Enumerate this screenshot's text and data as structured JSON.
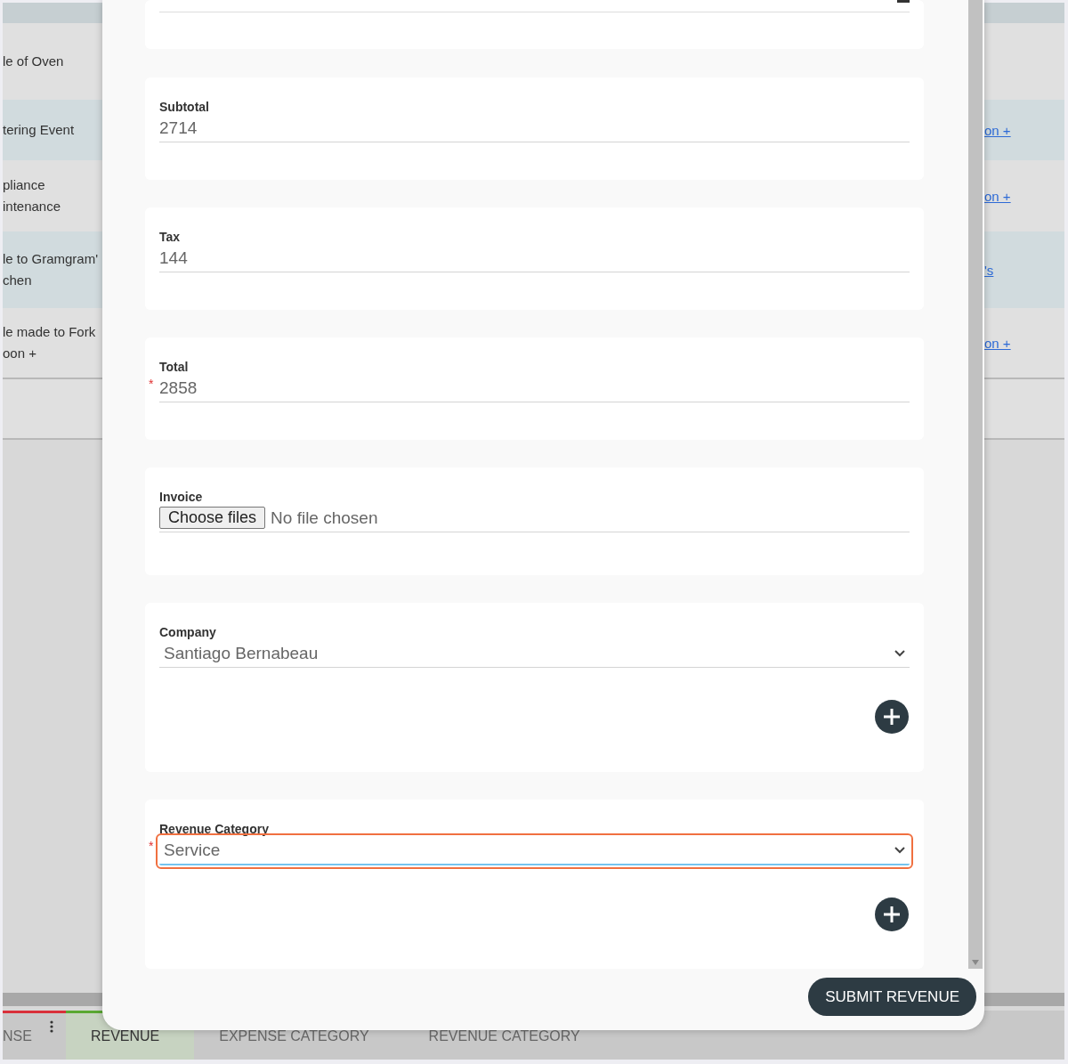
{
  "background_table": {
    "rows": [
      {
        "column_1": [
          "le of Oven"
        ]
      },
      {
        "column_1": [
          "tering Event"
        ],
        "column_2": "on +"
      },
      {
        "column_1": [
          "pliance",
          "intenance"
        ],
        "column_2": "on +"
      },
      {
        "column_1": [
          "le to Gramgram'",
          "chen"
        ],
        "column_2": "'s"
      },
      {
        "column_1": [
          "le made to Fork",
          "oon +"
        ],
        "column_2": "on +"
      }
    ]
  },
  "tabs": [
    {
      "label": "NSE",
      "selected": false,
      "color": "#d9303a"
    },
    {
      "label": "REVENUE",
      "selected": true,
      "color": "#5aa832"
    },
    {
      "label": "EXPENSE CATEGORY",
      "selected": false
    },
    {
      "label": "REVENUE CATEGORY",
      "selected": false
    }
  ],
  "modal": {
    "fields": [
      {
        "kind": "text",
        "label": "Subtotal",
        "value": "2714",
        "highlighted": false
      },
      {
        "kind": "text",
        "label": "Tax",
        "value": "144",
        "highlighted": false
      },
      {
        "kind": "text",
        "label": "Total",
        "value": "2858",
        "required_mark": "*",
        "highlighted": false
      },
      {
        "kind": "file",
        "label": "Invoice",
        "button": "Choose files",
        "value": "No file chosen",
        "highlighted": false
      },
      {
        "kind": "select",
        "label": "Company",
        "value": "Santiago Bernabeau",
        "highlighted": false
      },
      {
        "kind": "select",
        "label": "Revenue Category",
        "value": "Service",
        "required_mark": "*",
        "highlighted": true
      }
    ],
    "submit": "SUBMIT REVENUE"
  }
}
